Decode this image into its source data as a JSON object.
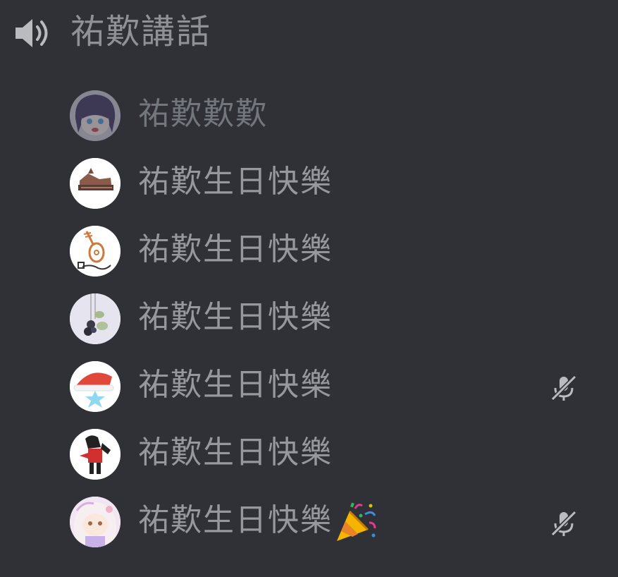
{
  "channel": {
    "icon": "speaker-icon",
    "name": "祐歎講話"
  },
  "members": [
    {
      "name": "祐歎歎歎",
      "avatar": "purple-hair-character",
      "muted": false,
      "dim": true,
      "emoji": null
    },
    {
      "name": "祐歎生日快樂",
      "avatar": "wooden-instrument",
      "muted": false,
      "dim": false,
      "emoji": null
    },
    {
      "name": "祐歎生日快樂",
      "avatar": "orange-lute-sketch",
      "muted": false,
      "dim": false,
      "emoji": null
    },
    {
      "name": "祐歎生日快樂",
      "avatar": "hanging-berries",
      "muted": false,
      "dim": false,
      "emoji": null
    },
    {
      "name": "祐歎生日快樂",
      "avatar": "santa-hat-star",
      "muted": true,
      "dim": false,
      "emoji": null
    },
    {
      "name": "祐歎生日快樂",
      "avatar": "red-black-character",
      "muted": false,
      "dim": false,
      "emoji": null
    },
    {
      "name": "祐歎生日快樂",
      "avatar": "pastel-anime-girl",
      "muted": true,
      "dim": false,
      "emoji": "party-popper-icon"
    }
  ],
  "colors": {
    "background": "#2f3136",
    "text": "#96989d",
    "icon": "#b9bbbe"
  }
}
